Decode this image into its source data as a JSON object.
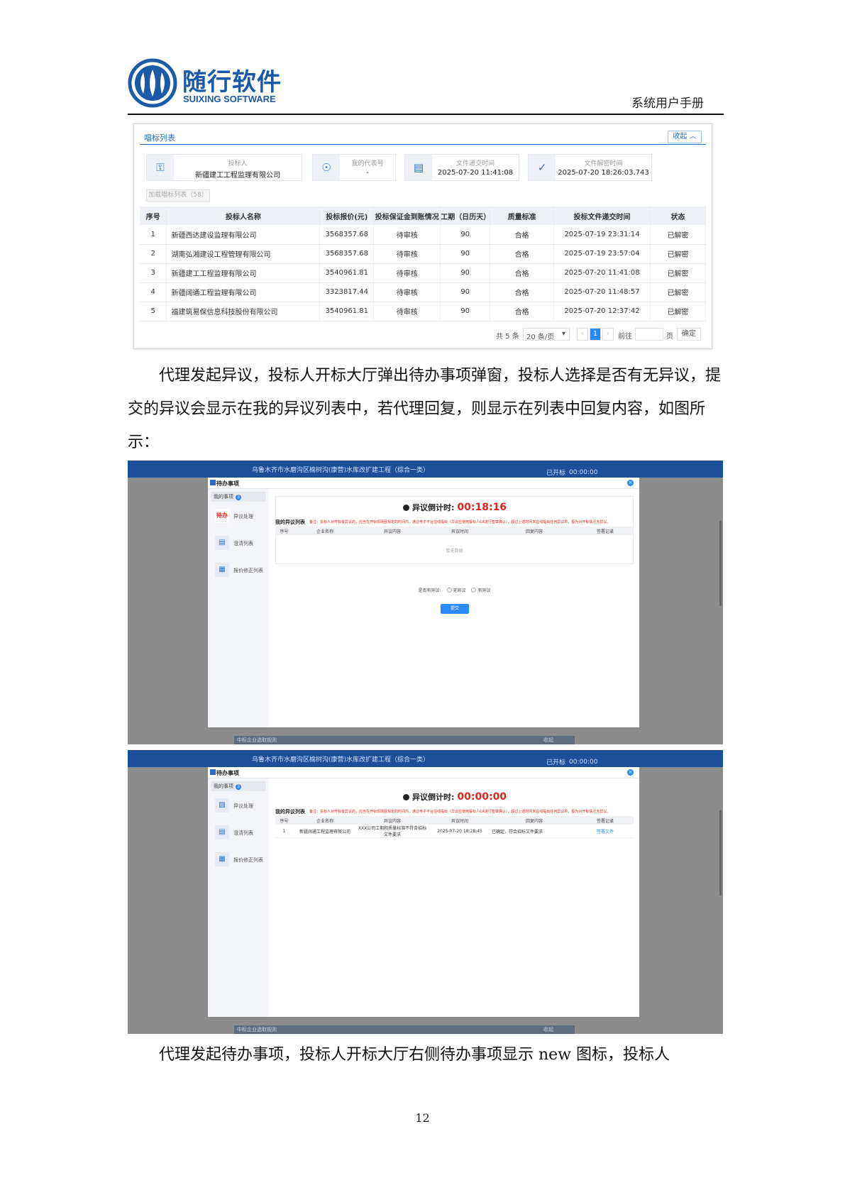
{
  "header": {
    "logo_cn": "随行软件",
    "logo_en": "SUIXING SOFTWARE",
    "doc_title": "系统用户手册"
  },
  "bid_list": {
    "title": "唱标列表",
    "collapse_label": "收起",
    "bidder": {
      "label": "投标人",
      "value": "新疆建工工程监理有限公司"
    },
    "agent_code": {
      "label": "我的代表号",
      "value": "-"
    },
    "submit_time": {
      "label": "文件递交时间",
      "value": "2025-07-20 11:41:08"
    },
    "decrypt_time": {
      "label": "文件解密时间",
      "value": "2025-07-20 18:26:03.743"
    },
    "load_button": "加载唱标列表（58）",
    "columns": [
      "序号",
      "投标人名称",
      "投标报价(元)",
      "投标保证金到账情况",
      "工期（日历天）",
      "质量标准",
      "投标文件递交时间",
      "状态"
    ],
    "rows": [
      [
        "1",
        "新疆西达建设监理有限公司",
        "3568357.68",
        "待审核",
        "90",
        "合格",
        "2025-07-19 23:31:14",
        "已解密"
      ],
      [
        "2",
        "湖南弘湘建设工程管理有限公司",
        "3568357.68",
        "待审核",
        "90",
        "合格",
        "2025-07-19 23:57:04",
        "已解密"
      ],
      [
        "3",
        "新疆建工工程监理有限公司",
        "3540961.81",
        "待审核",
        "90",
        "合格",
        "2025-07-20 11:41:08",
        "已解密"
      ],
      [
        "4",
        "新疆阔通工程监理有限公司",
        "3323817.44",
        "待审核",
        "90",
        "合格",
        "2025-07-20 11:48:57",
        "已解密"
      ],
      [
        "5",
        "福建筑易保信息科技股份有限公司",
        "3540961.81",
        "待审核",
        "90",
        "合格",
        "2025-07-20 12:37:42",
        "已解密"
      ]
    ],
    "pager": {
      "total": "共 5 条",
      "page_size": "20 条/页",
      "current": "1",
      "goto": "前往",
      "page_unit": "页",
      "confirm": "确定"
    }
  },
  "paragraph1": "代理发起异议，投标人开标大厅弹出待办事项弹窗，投标人选择是否有无异议，提交的异议会显示在我的异议列表中，若代理回复，则显示在列表中回复内容，如图所示：",
  "shots": {
    "topbar_title": "乌鲁木齐市水磨沟区榆树沟(康营)水库改扩建工程（综合一类）",
    "topbar_clock": "00:00:00",
    "topbar_status": "已开标",
    "modal_title": "待办事项",
    "my_items": "我的事项",
    "my_items_count": "3",
    "nav_objection": "异议处理",
    "nav_clarify": "澄清列表",
    "nav_price": "报价修正列表",
    "todo_badge": "待办",
    "countdown_label": "异议倒计时:",
    "objection_list_title": "我的异议列表",
    "objection_note": "备注：投标人对开标有异议的，应当在开标现场且规定的时间内，通过电子平台在线提出（异议应使用投标人CA进行签章确认），超过上述时间未在线提出任何异议的，视为对开标情况无异议。",
    "columns": [
      "序号",
      "企业名称",
      "异议内容",
      "异议时间",
      "回复内容",
      "签署记录"
    ],
    "bottom_label": "中标企业选取规则",
    "bottom_right": "收起"
  },
  "shot2": {
    "countdown": "00:18:16",
    "no_data": "暂无数据",
    "question": "是否有异议:",
    "option_none": "无异议",
    "option_yes": "有异议",
    "submit": "提交"
  },
  "shot3": {
    "countdown": "00:00:00",
    "row": [
      "1",
      "新疆阔通工程监理有限公司",
      "XXX公司工期和质量标准不符合招标文件要求",
      "2025-07-20 18:28:45",
      "已确定，符合招标文件要求",
      "签署文件"
    ]
  },
  "paragraph2": "代理发起待办事项，投标人开标大厅右侧待办事项显示 new 图标，投标人",
  "page_number": "12"
}
